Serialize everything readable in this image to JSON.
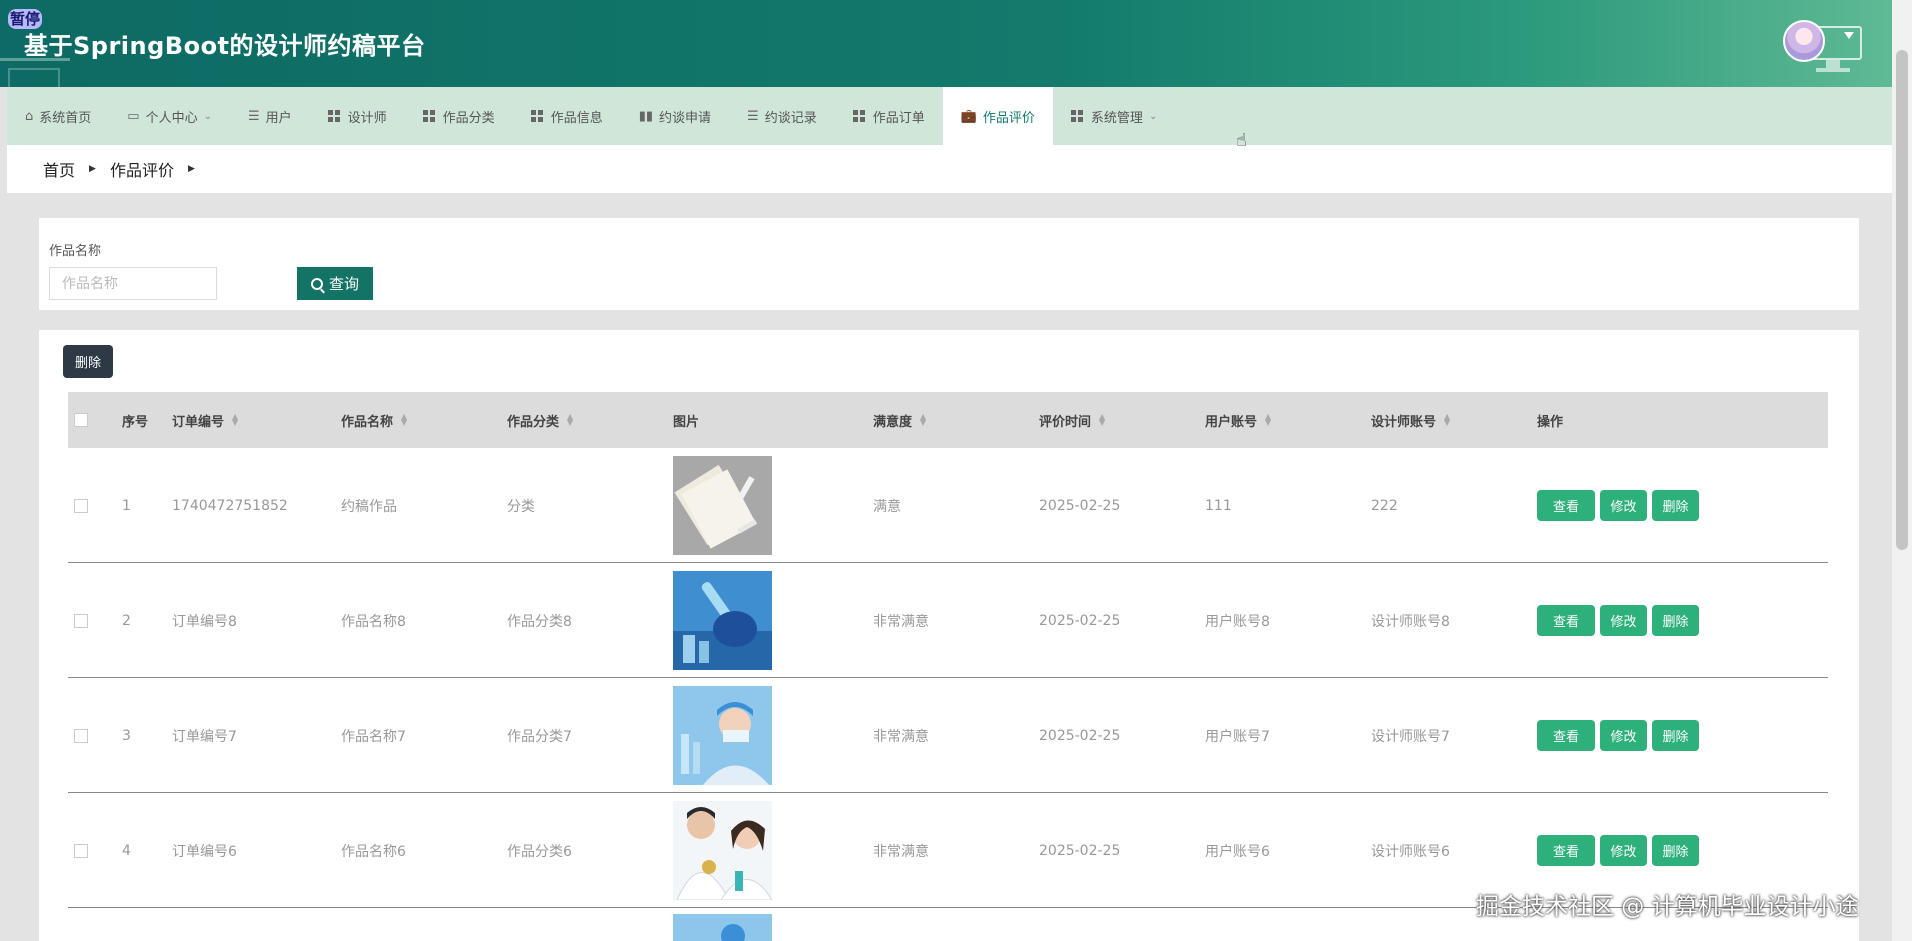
{
  "header": {
    "pause_tag": "暂停",
    "title": "基于SpringBoot的设计师约稿平台"
  },
  "nav": {
    "items": [
      {
        "label": "系统首页",
        "icon": "home-icon"
      },
      {
        "label": "个人中心",
        "icon": "card-icon"
      },
      {
        "label": "用户",
        "icon": "list-icon"
      },
      {
        "label": "设计师",
        "icon": "grid-icon"
      },
      {
        "label": "作品分类",
        "icon": "grid-icon"
      },
      {
        "label": "作品信息",
        "icon": "grid-icon"
      },
      {
        "label": "约谈申请",
        "icon": "bar-chart-icon"
      },
      {
        "label": "约谈记录",
        "icon": "list-icon"
      },
      {
        "label": "作品订单",
        "icon": "grid-icon"
      },
      {
        "label": "作品评价",
        "icon": "briefcase-icon",
        "active": true
      },
      {
        "label": "系统管理",
        "icon": "grid-icon"
      }
    ]
  },
  "breadcrumb": {
    "home": "首页",
    "current": "作品评价"
  },
  "search": {
    "label": "作品名称",
    "placeholder": "作品名称",
    "button": "查询"
  },
  "toolbar": {
    "delete_label": "删除"
  },
  "table": {
    "headers": {
      "index": "序号",
      "order_no": "订单编号",
      "work_name": "作品名称",
      "category": "作品分类",
      "image": "图片",
      "satisfaction": "满意度",
      "review_time": "评价时间",
      "user_account": "用户账号",
      "designer_account": "设计师账号",
      "actions": "操作"
    },
    "rows": [
      {
        "index": "1",
        "order_no": "1740472751852",
        "work_name": "约稿作品",
        "category": "分类",
        "satisfaction": "满意",
        "review_time": "2025-02-25",
        "user_account": "111",
        "designer_account": "222"
      },
      {
        "index": "2",
        "order_no": "订单编号8",
        "work_name": "作品名称8",
        "category": "作品分类8",
        "satisfaction": "非常满意",
        "review_time": "2025-02-25",
        "user_account": "用户账号8",
        "designer_account": "设计师账号8"
      },
      {
        "index": "3",
        "order_no": "订单编号7",
        "work_name": "作品名称7",
        "category": "作品分类7",
        "satisfaction": "非常满意",
        "review_time": "2025-02-25",
        "user_account": "用户账号7",
        "designer_account": "设计师账号7"
      },
      {
        "index": "4",
        "order_no": "订单编号6",
        "work_name": "作品名称6",
        "category": "作品分类6",
        "satisfaction": "非常满意",
        "review_time": "2025-02-25",
        "user_account": "用户账号6",
        "designer_account": "设计师账号6"
      }
    ],
    "actions": {
      "view": "查看",
      "edit": "修改",
      "delete": "删除"
    }
  },
  "watermark": "掘金技术社区 @ 计算机毕业设计小途",
  "colors": {
    "header": "#137a6c",
    "nav_bg": "#cfe6d9",
    "primary_btn": "#2eb07b",
    "search_btn": "#137364",
    "dark_btn": "#2d3a45"
  }
}
